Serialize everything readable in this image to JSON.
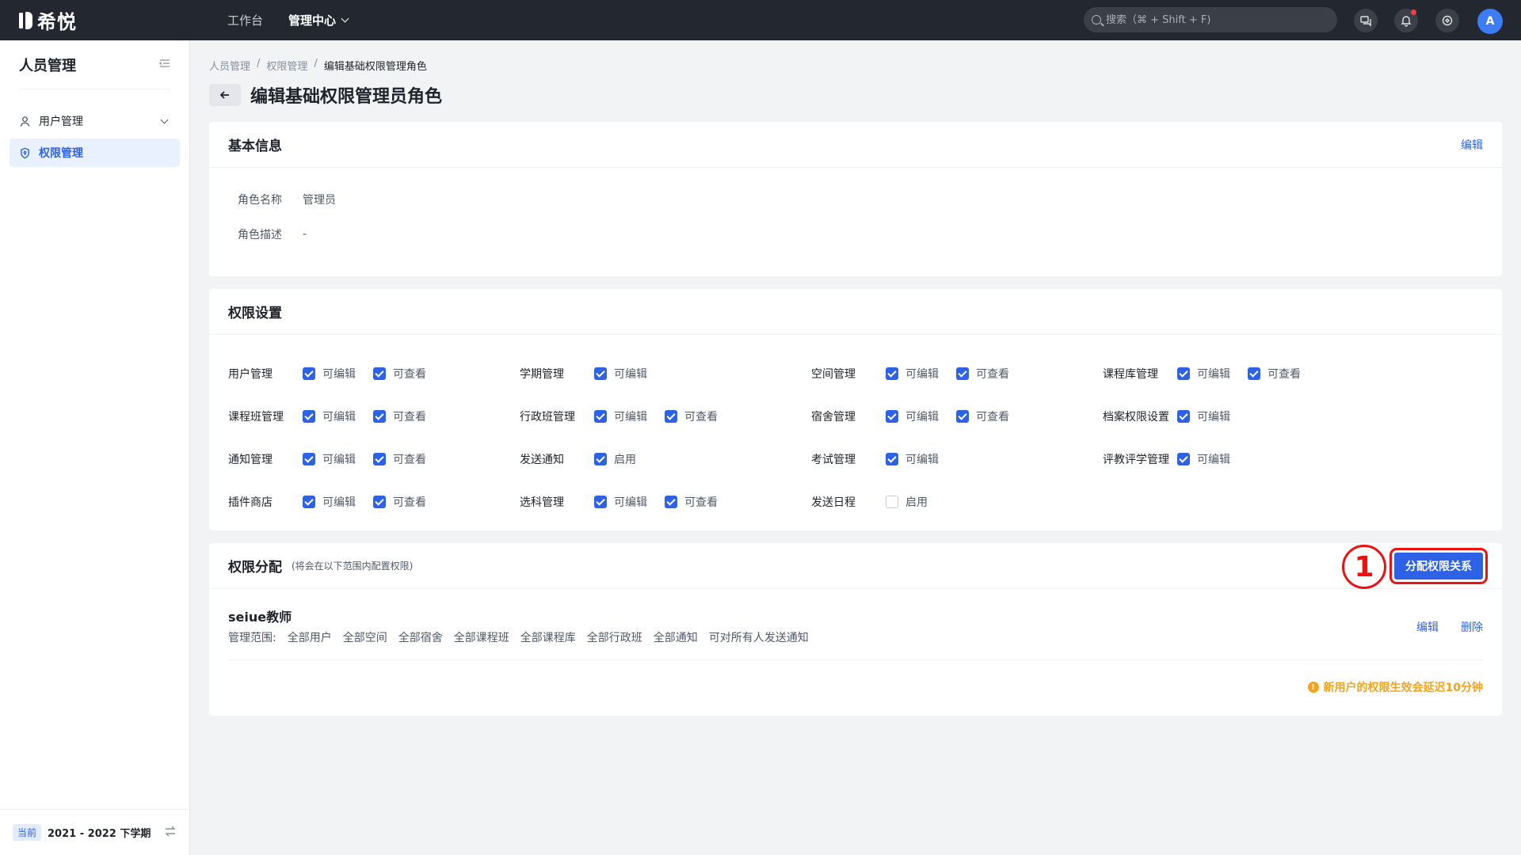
{
  "topbar": {
    "logo": "希悦",
    "nav": [
      {
        "label": "工作台"
      },
      {
        "label": "管理中心"
      }
    ],
    "search_placeholder": "搜索（⌘ + Shift + F)",
    "avatar": "A"
  },
  "sidebar": {
    "title": "人员管理",
    "items": [
      {
        "label": "用户管理",
        "icon": "user-icon"
      },
      {
        "label": "权限管理",
        "icon": "shield-icon",
        "active": true
      }
    ],
    "term_badge": "当前",
    "term": "2021 - 2022 下学期"
  },
  "breadcrumb": [
    "人员管理",
    "权限管理",
    "编辑基础权限管理角色"
  ],
  "breadcrumb_sep": "/",
  "page_title": "编辑基础权限管理员角色",
  "basic_info": {
    "title": "基本信息",
    "edit_label": "编辑",
    "rows": [
      {
        "key": "角色名称",
        "value": "管理员"
      },
      {
        "key": "角色描述",
        "value": "-"
      }
    ]
  },
  "permissions": {
    "title": "权限设置",
    "cells": [
      {
        "name": "用户管理",
        "options": [
          {
            "label": "可编辑",
            "checked": true
          },
          {
            "label": "可查看",
            "checked": true
          }
        ]
      },
      {
        "name": "学期管理",
        "options": [
          {
            "label": "可编辑",
            "checked": true
          }
        ]
      },
      {
        "name": "空间管理",
        "options": [
          {
            "label": "可编辑",
            "checked": true
          },
          {
            "label": "可查看",
            "checked": true
          }
        ]
      },
      {
        "name": "课程库管理",
        "options": [
          {
            "label": "可编辑",
            "checked": true
          },
          {
            "label": "可查看",
            "checked": true
          }
        ]
      },
      {
        "name": "课程班管理",
        "options": [
          {
            "label": "可编辑",
            "checked": true
          },
          {
            "label": "可查看",
            "checked": true
          }
        ]
      },
      {
        "name": "行政班管理",
        "options": [
          {
            "label": "可编辑",
            "checked": true
          },
          {
            "label": "可查看",
            "checked": true
          }
        ]
      },
      {
        "name": "宿舍管理",
        "options": [
          {
            "label": "可编辑",
            "checked": true
          },
          {
            "label": "可查看",
            "checked": true
          }
        ]
      },
      {
        "name": "档案权限设置",
        "options": [
          {
            "label": "可编辑",
            "checked": true
          }
        ]
      },
      {
        "name": "通知管理",
        "options": [
          {
            "label": "可编辑",
            "checked": true
          },
          {
            "label": "可查看",
            "checked": true
          }
        ]
      },
      {
        "name": "发送通知",
        "options": [
          {
            "label": "启用",
            "checked": true
          }
        ]
      },
      {
        "name": "考试管理",
        "options": [
          {
            "label": "可编辑",
            "checked": true
          }
        ]
      },
      {
        "name": "评教评学管理",
        "options": [
          {
            "label": "可编辑",
            "checked": true
          }
        ]
      },
      {
        "name": "插件商店",
        "options": [
          {
            "label": "可编辑",
            "checked": true
          },
          {
            "label": "可查看",
            "checked": true
          }
        ]
      },
      {
        "name": "选科管理",
        "options": [
          {
            "label": "可编辑",
            "checked": true
          },
          {
            "label": "可查看",
            "checked": true
          }
        ]
      },
      {
        "name": "发送日程",
        "options": [
          {
            "label": "启用",
            "checked": false
          }
        ]
      }
    ]
  },
  "assignment": {
    "title": "权限分配",
    "subtitle": "(将会在以下范围内配置权限)",
    "assign_button": "分配权限关系",
    "step_marker": "1",
    "role": {
      "name": "seiue教师",
      "scope_label": "管理范围:",
      "scope": [
        "全部用户",
        "全部空间",
        "全部宿舍",
        "全部课程班",
        "全部课程库",
        "全部行政班",
        "全部通知",
        "可对所有人发送通知"
      ],
      "edit_label": "编辑",
      "delete_label": "删除"
    },
    "warning": "新用户的权限生效会延迟10分钟"
  }
}
